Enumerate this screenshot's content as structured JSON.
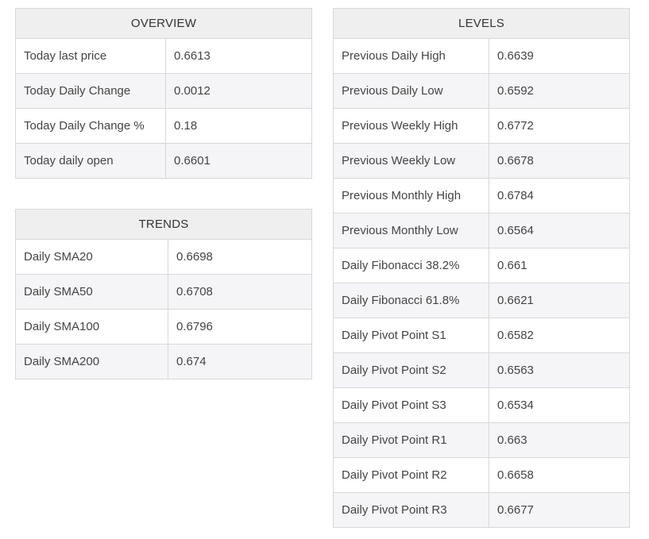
{
  "overview": {
    "title": "OVERVIEW",
    "rows": [
      {
        "label": "Today last price",
        "value": "0.6613"
      },
      {
        "label": "Today Daily Change",
        "value": "0.0012"
      },
      {
        "label": "Today Daily Change %",
        "value": "0.18"
      },
      {
        "label": "Today daily open",
        "value": "0.6601"
      }
    ]
  },
  "trends": {
    "title": "TRENDS",
    "rows": [
      {
        "label": "Daily SMA20",
        "value": "0.6698"
      },
      {
        "label": "Daily SMA50",
        "value": "0.6708"
      },
      {
        "label": "Daily SMA100",
        "value": "0.6796"
      },
      {
        "label": "Daily SMA200",
        "value": "0.674"
      }
    ]
  },
  "levels": {
    "title": "LEVELS",
    "rows": [
      {
        "label": "Previous Daily High",
        "value": "0.6639"
      },
      {
        "label": "Previous Daily Low",
        "value": "0.6592"
      },
      {
        "label": "Previous Weekly High",
        "value": "0.6772"
      },
      {
        "label": "Previous Weekly Low",
        "value": "0.6678"
      },
      {
        "label": "Previous Monthly High",
        "value": "0.6784"
      },
      {
        "label": "Previous Monthly Low",
        "value": "0.6564"
      },
      {
        "label": "Daily Fibonacci 38.2%",
        "value": "0.661"
      },
      {
        "label": "Daily Fibonacci 61.8%",
        "value": "0.6621"
      },
      {
        "label": "Daily Pivot Point S1",
        "value": "0.6582"
      },
      {
        "label": "Daily Pivot Point S2",
        "value": "0.6563"
      },
      {
        "label": "Daily Pivot Point S3",
        "value": "0.6534"
      },
      {
        "label": "Daily Pivot Point R1",
        "value": "0.663"
      },
      {
        "label": "Daily Pivot Point R2",
        "value": "0.6658"
      },
      {
        "label": "Daily Pivot Point R3",
        "value": "0.6677"
      }
    ]
  }
}
